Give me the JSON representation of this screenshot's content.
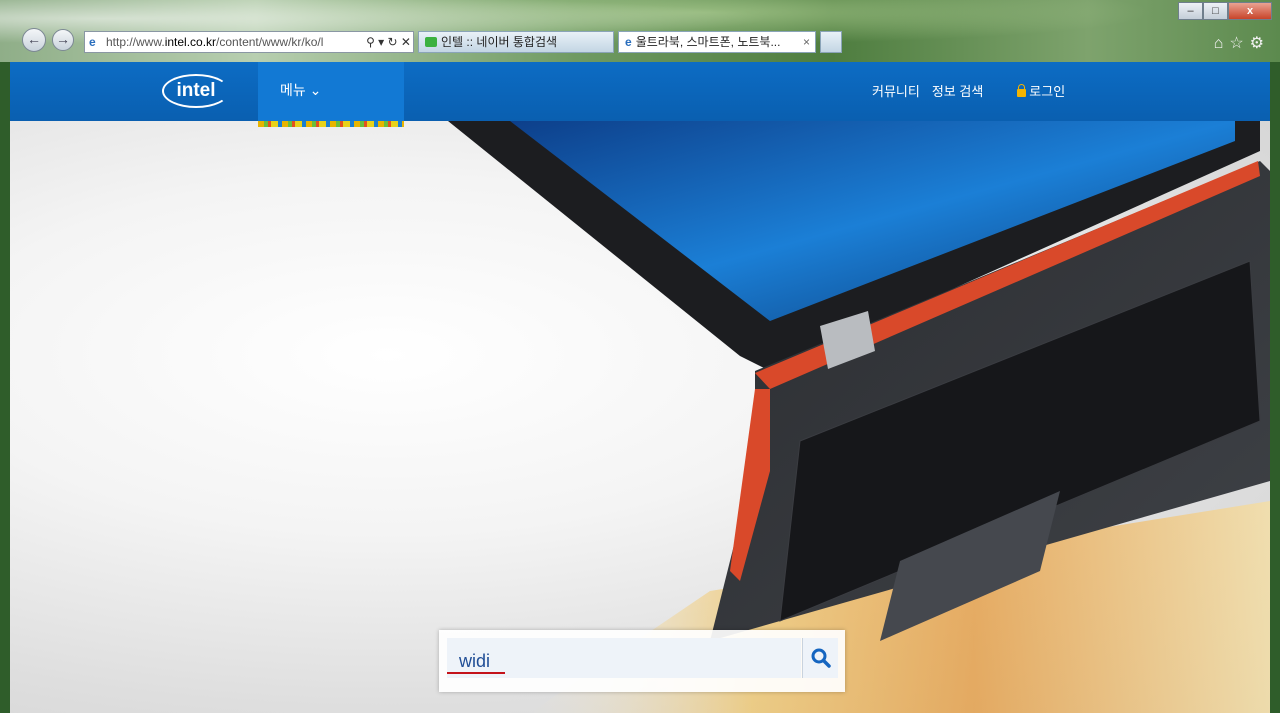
{
  "browser": {
    "address": {
      "prefix": "http://www.",
      "domain": "intel.co.kr",
      "path": "/content/www/kr/ko/l",
      "controls": "⚲ ▾ ↻ ✕"
    },
    "tabs": [
      {
        "label": "인텔 :: 네이버 통합검색"
      },
      {
        "label": "울트라북, 스마트폰, 노트북...",
        "close": "×"
      }
    ],
    "window_controls": {
      "minimize": "–",
      "maximize": "□",
      "close": "x"
    },
    "tool_icons": {
      "home": "⌂",
      "favorites": "☆",
      "settings": "⚙"
    }
  },
  "site": {
    "logo": "intel",
    "menu_label": "메뉴 ⌄",
    "nav": {
      "community": "커뮤니티",
      "info_search": "정보 검색",
      "login": "로그인"
    },
    "search": {
      "value": "widi"
    }
  }
}
